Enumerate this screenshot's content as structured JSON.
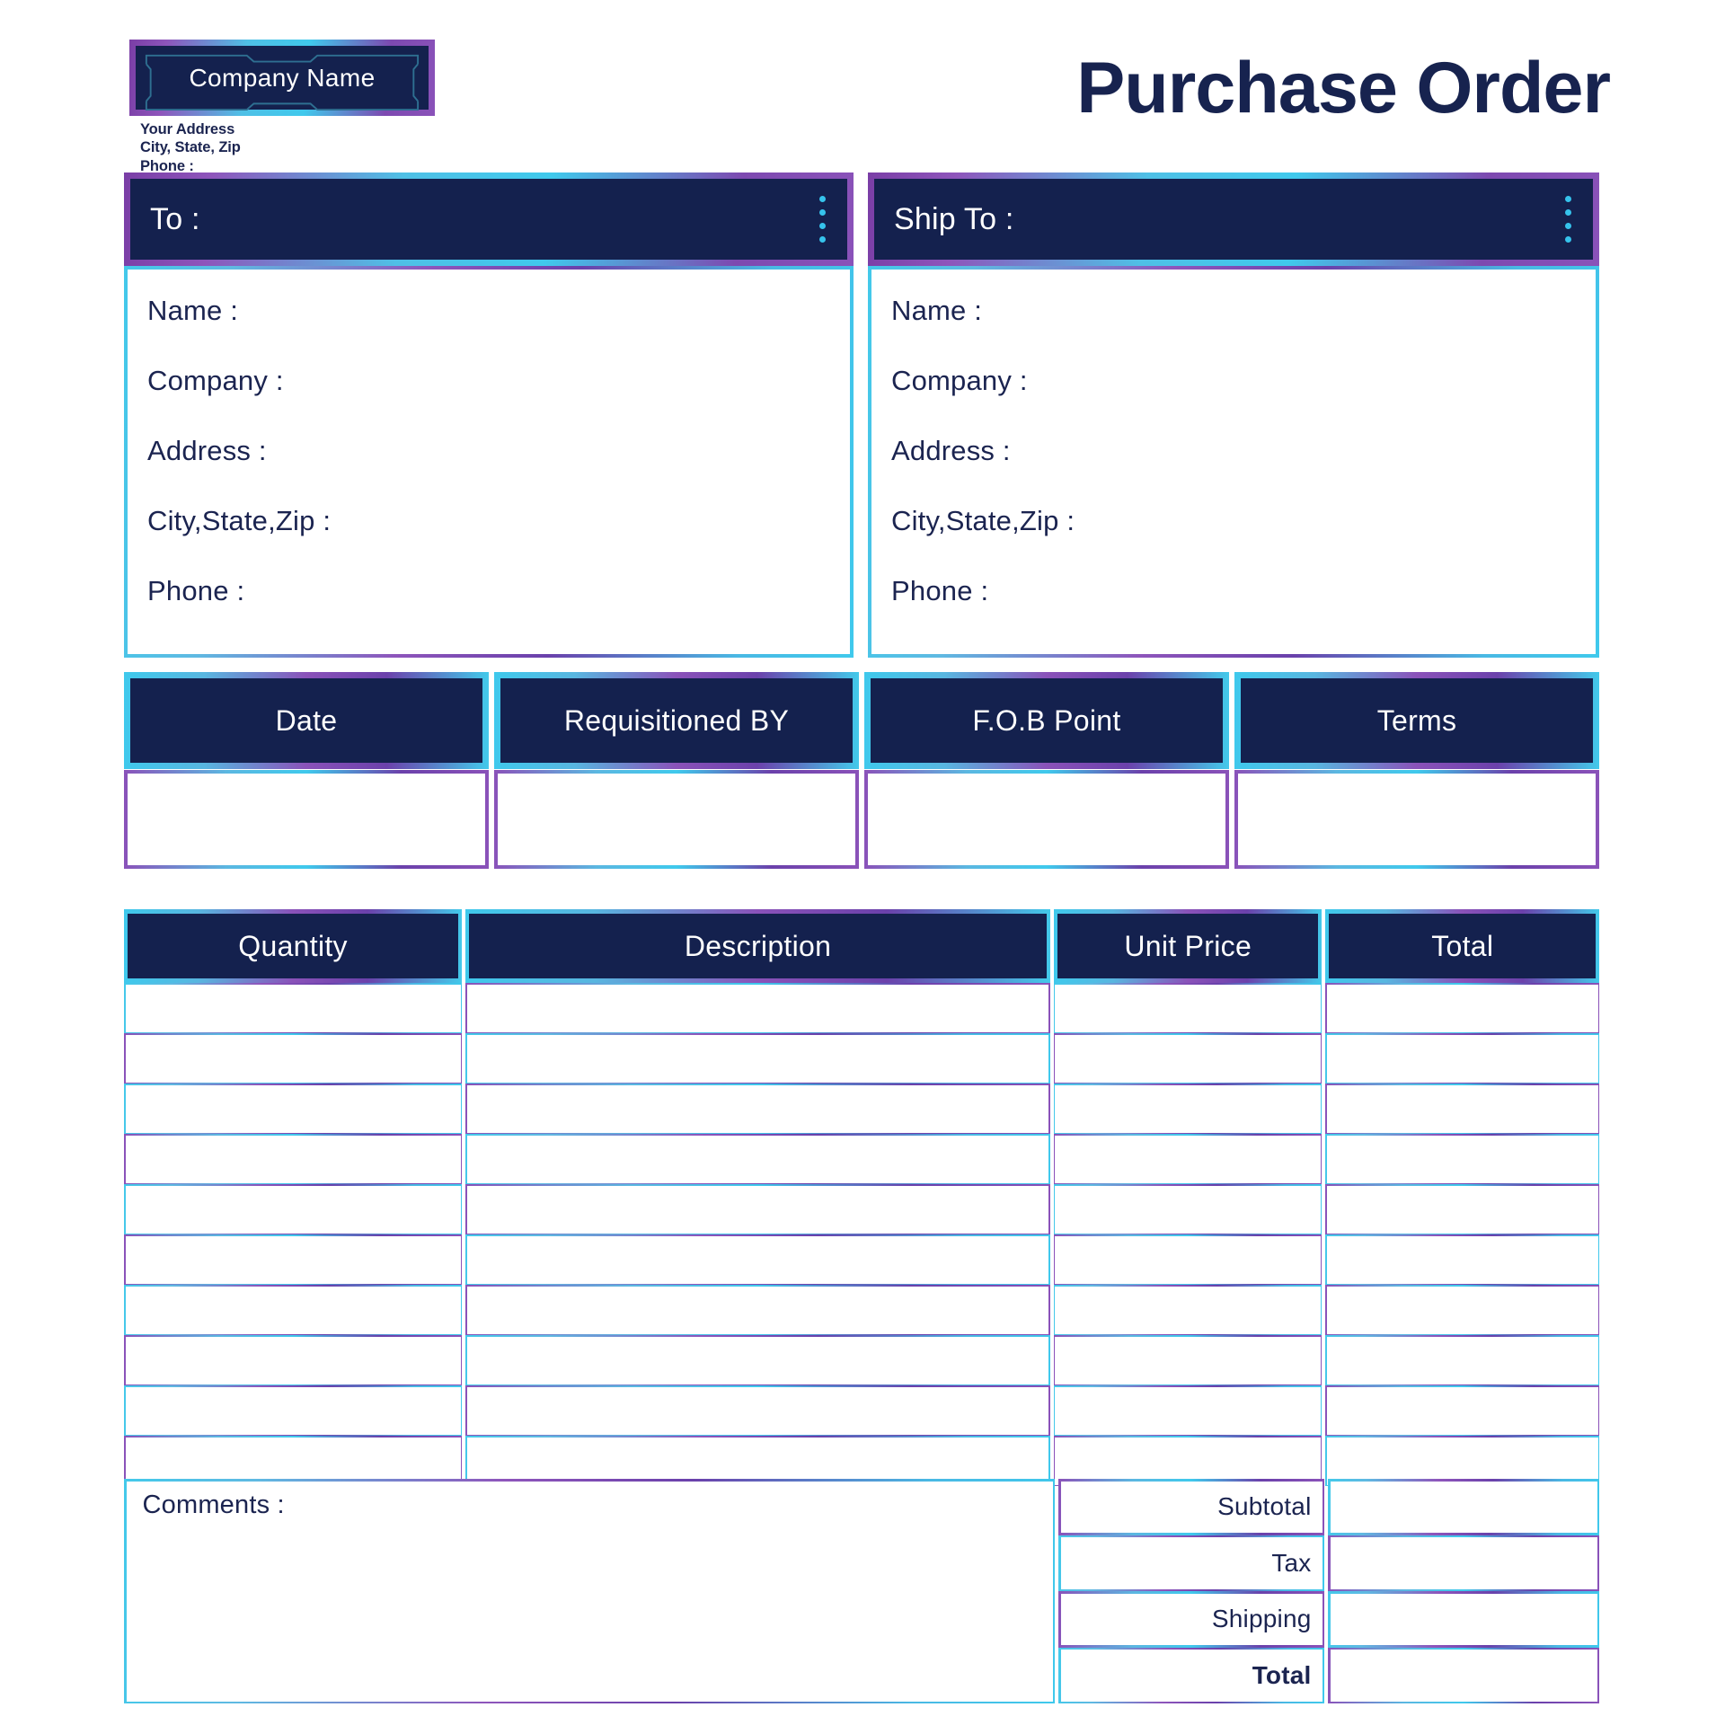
{
  "document": {
    "title": "Purchase Order"
  },
  "company": {
    "logo_label": "Company Name",
    "address_line1": "Your Address",
    "address_line2": "City, State, Zip",
    "address_line3": "Phone :"
  },
  "bill_to": {
    "header": "To :",
    "menu_icon": "four-dots-icon",
    "fields": [
      {
        "label": "Name :",
        "value": ""
      },
      {
        "label": "Company :",
        "value": ""
      },
      {
        "label": "Address :",
        "value": ""
      },
      {
        "label": "City,State,Zip :",
        "value": ""
      },
      {
        "label": "Phone :",
        "value": ""
      }
    ]
  },
  "ship_to": {
    "header": "Ship To :",
    "menu_icon": "four-dots-icon",
    "fields": [
      {
        "label": "Name :",
        "value": ""
      },
      {
        "label": "Company :",
        "value": ""
      },
      {
        "label": "Address :",
        "value": ""
      },
      {
        "label": "City,State,Zip :",
        "value": ""
      },
      {
        "label": "Phone :",
        "value": ""
      }
    ]
  },
  "meta": {
    "columns": [
      {
        "label": "Date",
        "value": ""
      },
      {
        "label": "Requisitioned BY",
        "value": ""
      },
      {
        "label": "F.O.B Point",
        "value": ""
      },
      {
        "label": "Terms",
        "value": ""
      }
    ]
  },
  "items_table": {
    "headers": [
      "Quantity",
      "Description",
      "Unit Price",
      "Total"
    ],
    "rows": [
      {
        "quantity": "",
        "description": "",
        "unit_price": "",
        "total": ""
      },
      {
        "quantity": "",
        "description": "",
        "unit_price": "",
        "total": ""
      },
      {
        "quantity": "",
        "description": "",
        "unit_price": "",
        "total": ""
      },
      {
        "quantity": "",
        "description": "",
        "unit_price": "",
        "total": ""
      },
      {
        "quantity": "",
        "description": "",
        "unit_price": "",
        "total": ""
      },
      {
        "quantity": "",
        "description": "",
        "unit_price": "",
        "total": ""
      },
      {
        "quantity": "",
        "description": "",
        "unit_price": "",
        "total": ""
      },
      {
        "quantity": "",
        "description": "",
        "unit_price": "",
        "total": ""
      },
      {
        "quantity": "",
        "description": "",
        "unit_price": "",
        "total": ""
      },
      {
        "quantity": "",
        "description": "",
        "unit_price": "",
        "total": ""
      }
    ]
  },
  "comments": {
    "label": "Comments :",
    "value": ""
  },
  "totals": {
    "rows": [
      {
        "label": "Subtotal",
        "value": "",
        "bold": false
      },
      {
        "label": "Tax",
        "value": "",
        "bold": false
      },
      {
        "label": "Shipping",
        "value": "",
        "bold": false
      },
      {
        "label": "Total",
        "value": "",
        "bold": true
      }
    ]
  },
  "colors": {
    "dark_navy": "#14214e",
    "text_navy": "#1b2450",
    "accent_cyan": "#3fc9ec",
    "accent_purple": "#8a52b9",
    "accent_violet": "#6b41ab",
    "white": "#ffffff"
  }
}
